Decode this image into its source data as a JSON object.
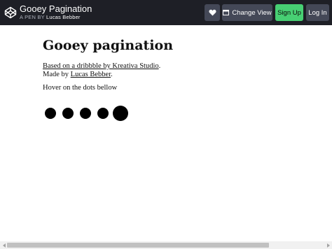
{
  "header": {
    "title": "Gooey Pagination",
    "byline_prefix": "A PEN BY",
    "author": "Lucas Bebber",
    "heart_icon": "heart-icon",
    "change_view_label": "Change View",
    "sign_up_label": "Sign Up",
    "log_in_label": "Log In",
    "colors": {
      "bar": "#1e1f26",
      "button": "#444857",
      "signup": "#47cf73"
    }
  },
  "content": {
    "heading": "Gooey pagination",
    "credit_link": "Based on a dribbble by Kreativa Studio",
    "credit_period": ".",
    "made_by_prefix": "Made by ",
    "made_by_link": "Lucas Bebber",
    "made_by_period": ".",
    "hover_text": "Hover on the dots bellow",
    "dots": [
      {
        "label": "page-1",
        "active": false
      },
      {
        "label": "page-2",
        "active": false
      },
      {
        "label": "page-3",
        "active": false
      },
      {
        "label": "page-4",
        "active": false
      },
      {
        "label": "page-5",
        "active": true
      }
    ]
  }
}
